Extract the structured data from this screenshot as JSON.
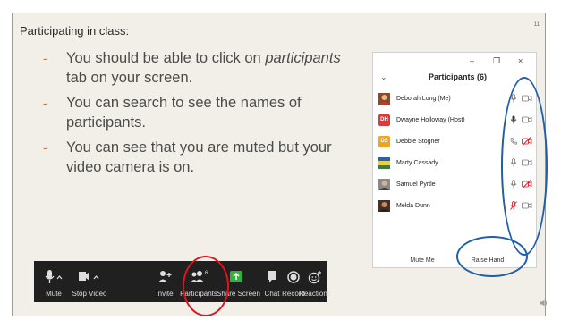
{
  "slide": {
    "number": "11",
    "section_title": "Participating in class:",
    "bullets": [
      {
        "pre": "You should be able to click on ",
        "em": "participants",
        "post": " tab on your screen."
      },
      {
        "pre": "You can search to see the names of participants.",
        "em": "",
        "post": ""
      },
      {
        "pre": "You can see that you are muted but your video camera is on.",
        "em": "",
        "post": ""
      }
    ]
  },
  "toolbar": {
    "mute": "Mute",
    "stop_video": "Stop Video",
    "invite": "Invite",
    "participants": "Participants",
    "participants_count": "6",
    "share_screen": "Share Screen",
    "chat": "Chat",
    "record": "Record",
    "reactions": "Reactions"
  },
  "panel": {
    "title": "Participants (6)",
    "minimize": "–",
    "restore": "❐",
    "close": "×",
    "collapse": "⌄",
    "participants": [
      {
        "name": "Deborah Long (Me)",
        "initials": "",
        "avatar_color": "#b5652b",
        "mic": "on",
        "video": "on"
      },
      {
        "name": "Dwayne Holloway (Host)",
        "initials": "DH",
        "avatar_color": "#d93a3a",
        "mic": "on-dark",
        "video": "on"
      },
      {
        "name": "Debbie Stogner",
        "initials": "DS",
        "avatar_color": "#f0a51e",
        "mic": "phone",
        "video": "off"
      },
      {
        "name": "Marty Cassady",
        "initials": "",
        "avatar_color": "#3a7d44",
        "mic": "on",
        "video": "on"
      },
      {
        "name": "Samuel Pyrtle",
        "initials": "",
        "avatar_color": "#6b5a4c",
        "mic": "on",
        "video": "off"
      },
      {
        "name": "Melda Dunn",
        "initials": "",
        "avatar_color": "#5a3a2a",
        "mic": "muted",
        "video": "on"
      }
    ],
    "mute_me": "Mute Me",
    "raise_hand": "Raise Hand"
  },
  "colors": {
    "annotation_blue": "#1f5fa8",
    "annotation_red": "#e0141c",
    "bullet_dash": "#d3742c",
    "toolbar_bg": "#202020",
    "muted_red": "#e0141c"
  }
}
